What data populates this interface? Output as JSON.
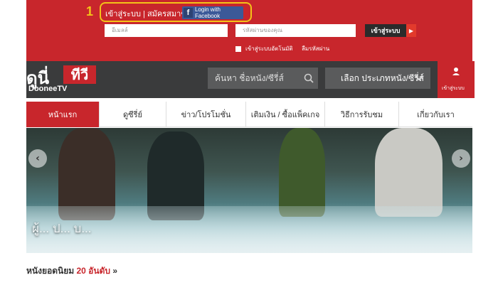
{
  "annotation": {
    "step": "1"
  },
  "login": {
    "login_link": "เข้าสู่ระบบ",
    "separator": "|",
    "register_link": "สมัครสมาชิก",
    "facebook_button": "Login with Facebook",
    "username_placeholder": "อีเมลล์",
    "password_placeholder": "รหัสผ่านของคุณ",
    "submit_label": "เข้าสู่ระบบ",
    "remember_label": "เข้าสู่ระบบอัตโนมัติ",
    "forgot_label": "ลืมรหัสผ่าน"
  },
  "header": {
    "logo_text": "ดูนี่",
    "logo_tv": "ทีวี",
    "logo_sub": "DooneeTV",
    "search_placeholder": "ค้นหา ชื่อหนัง/ซีรี่ส์",
    "category_select": "เลือก ประเภทหนัง/ซีรี่ส์",
    "account_label": "เข้าสู่ระบบ"
  },
  "nav": {
    "items": [
      {
        "label": "หน้าแรก"
      },
      {
        "label": "ดูซีรี่ย์"
      },
      {
        "label": "ข่าว/โปรโมชั่น"
      },
      {
        "label": "เติมเงิน / ซื้อแพ็คเกจ"
      },
      {
        "label": "วิธีการรับชม"
      },
      {
        "label": "เกี่ยวกับเรา"
      }
    ]
  },
  "hero": {
    "caption": "ผู้... ป... บ..."
  },
  "section": {
    "title_main": "หนังยอดนิยม",
    "title_highlight": "20 อันดับ",
    "title_arrow": "»"
  },
  "colors": {
    "brand_red": "#c8262c",
    "header_dark": "#3a3b3c",
    "highlight_yellow": "#f3c318",
    "facebook_blue": "#3b5998"
  }
}
